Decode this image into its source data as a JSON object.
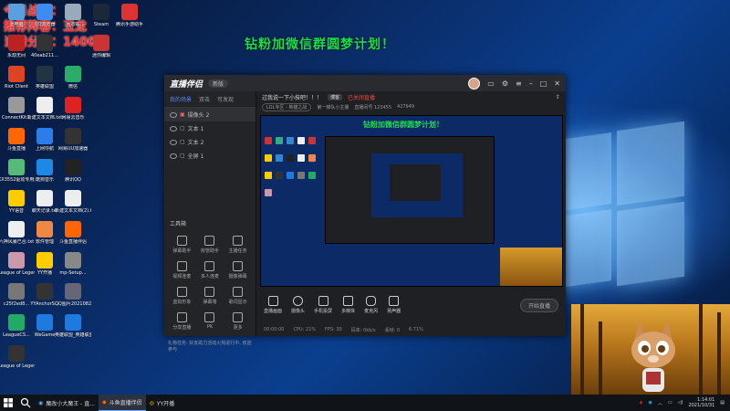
{
  "overlay_lines": [
    "今日战绩：",
    "推荐阵容：五龙",
    "当前分数：1400"
  ],
  "slogan": "钻粉加微信群圆梦计划！",
  "desktop_icons": [
    {
      "label": "此电脑",
      "color": "#5aa0e0"
    },
    {
      "label": "QQ浏览器",
      "color": "#3d8df0"
    },
    {
      "label": "回收站",
      "color": "#9ab"
    },
    {
      "label": "Steam",
      "color": "#1b2838"
    },
    {
      "label": "腾讯手游助手",
      "color": "#d33"
    },
    {
      "label": "永劫无间",
      "color": "#b22"
    },
    {
      "label": "40eab211...",
      "color": "#333"
    },
    {
      "label": "迷你编辑",
      "color": "#c33"
    },
    {
      "label": "Riot Client",
      "color": "#d42"
    },
    {
      "label": "英雄联盟",
      "color": "#234"
    },
    {
      "label": "微信",
      "color": "#2aae67"
    },
    {
      "label": "ConnectKit...",
      "color": "#999"
    },
    {
      "label": "新建文本文档.txt",
      "color": "#eee"
    },
    {
      "label": "网易云音乐",
      "color": "#d22"
    },
    {
      "label": "斗鱼直播",
      "color": "#f60"
    },
    {
      "label": "上网导航",
      "color": "#2b7de9"
    },
    {
      "label": "网易UU加速器",
      "color": "#333"
    },
    {
      "label": "KX3552驱动专用版.exe",
      "color": "#5b7"
    },
    {
      "label": "酷狗音乐",
      "color": "#1e88e5"
    },
    {
      "label": "腾讯QQ",
      "color": "#222"
    },
    {
      "label": "YY语音",
      "color": "#fc0"
    },
    {
      "label": "聊天记录.txt",
      "color": "#eee"
    },
    {
      "label": "新建文本文档(2).txt",
      "color": "#eee"
    },
    {
      "label": "六神风暴已合.txt",
      "color": "#eee"
    },
    {
      "label": "软件管理",
      "color": "#e84"
    },
    {
      "label": "斗鱼直播伴侣",
      "color": "#f60"
    },
    {
      "label": "League of Legends",
      "color": "#c9a"
    },
    {
      "label": "YY开播",
      "color": "#fc0"
    },
    {
      "label": "mp-Setup...",
      "color": "#888"
    },
    {
      "label": "c25f2ed8...",
      "color": "#777"
    },
    {
      "label": "YYAnchorS...",
      "color": "#333"
    },
    {
      "label": "QQ图片20210824...",
      "color": "#667"
    },
    {
      "label": "LeagueCS...",
      "color": "#2a6"
    },
    {
      "label": "WeGame",
      "color": "#1f7ae0"
    },
    {
      "label": "英雄联盟_英雄联盟...",
      "color": "#1f7ae0"
    },
    {
      "label": "League of Legends...",
      "color": "#333"
    }
  ],
  "app": {
    "name": "直播伴侣",
    "version": "新版",
    "left_tabs": [
      "我的场景",
      "双击",
      "可发现"
    ],
    "scenes": [
      "摄像头 2",
      "文本 1",
      "文本 2",
      "全屏 1"
    ],
    "tools_header": "工具箱",
    "tools": [
      "弹幕助手",
      "房管助手",
      "主播任务",
      "视频连麦",
      "多人连麦",
      "摄像弹幕",
      "虚拟形象",
      "弹幕墙",
      "歌词显示",
      "分享直播",
      "PK",
      "更多"
    ],
    "footer_notice": "礼物任务: 好友助力活动火热进行中, 欢迎参与",
    "info_title": "过我说一下小技吧！！！",
    "info_tag": "博客",
    "info_red": "已关闭直播",
    "info_line2": [
      "LOL专区 - 英雄之战",
      "第一梯队小主播",
      "直播间号 123455",
      "427949"
    ],
    "bottom_buttons": [
      "直播画面",
      "摄像头",
      "手机投屏",
      "多媒体",
      "麦克风",
      "扬声器"
    ],
    "start_button": "开始直播",
    "status": [
      "00:00:00",
      "CPU: 21%",
      "FPS: 30",
      "码率: 0kb/s",
      "丢帧: 0",
      "6.71%"
    ]
  },
  "preview_slogan": "钻粉加微信群圆梦计划！",
  "taskbar": {
    "items": [
      {
        "label": "魔改小大魔王 - 直...",
        "active": false
      },
      {
        "label": "斗鱼直播伴侣",
        "active": true
      },
      {
        "label": "YY开播",
        "active": false
      }
    ],
    "time": "1:14:01",
    "date": "2021/10/31"
  }
}
